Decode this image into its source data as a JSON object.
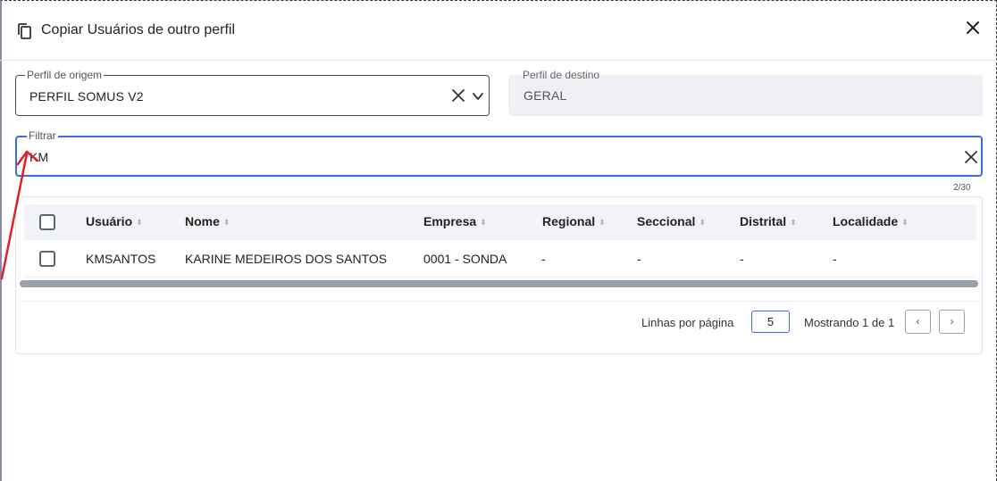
{
  "dialog": {
    "title": "Copiar Usuários de outro perfil",
    "copy_icon": "copy-icon",
    "close_icon": "close-icon"
  },
  "origin_profile": {
    "label": "Perfil de origem",
    "value": "PERFIL SOMUS V2"
  },
  "dest_profile": {
    "label": "Perfil de destino",
    "value": "GERAL"
  },
  "filter": {
    "label": "Filtrar",
    "value": "KM",
    "counter": "2/30"
  },
  "table": {
    "columns": [
      "Usuário",
      "Nome",
      "Empresa",
      "Regional",
      "Seccional",
      "Distrital",
      "Localidade"
    ],
    "rows": [
      [
        "KMSANTOS",
        "KARINE MEDEIROS DOS SANTOS",
        "0001 - SONDA",
        "-",
        "-",
        "-",
        "-"
      ]
    ]
  },
  "pagination": {
    "rows_per_page_label": "Linhas por página",
    "rows_per_page": "5",
    "showing": "Mostrando 1 de 1",
    "prev": "‹",
    "next": "›"
  },
  "colors": {
    "accent": "#3b6fe0",
    "annotation": "#e0202a"
  }
}
